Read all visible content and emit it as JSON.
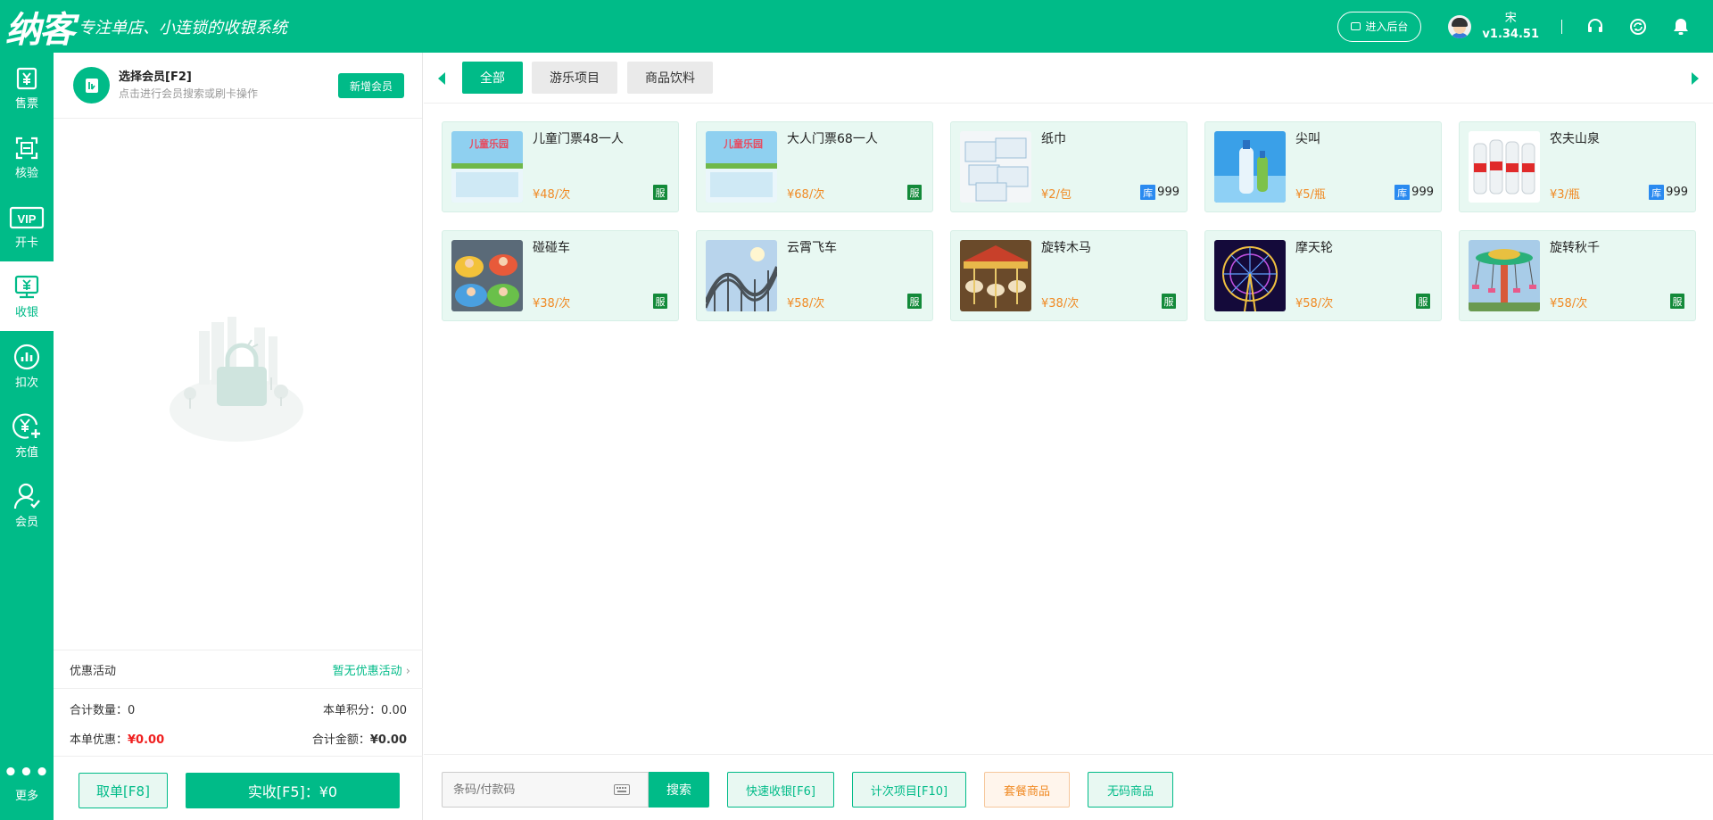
{
  "header": {
    "logo": "纳客",
    "slogan": "专注单店、小连锁的收银系统",
    "backend_label": "进入后台",
    "user_name": "宋",
    "version": "v1.34.51"
  },
  "sidebar": {
    "items": [
      {
        "label": "售票",
        "icon": "ticket-yen-icon"
      },
      {
        "label": "核验",
        "icon": "scan-icon"
      },
      {
        "label": "开卡",
        "icon": "vip-card-icon"
      },
      {
        "label": "收银",
        "icon": "cashier-icon"
      },
      {
        "label": "扣次",
        "icon": "chart-icon"
      },
      {
        "label": "充值",
        "icon": "recharge-icon"
      },
      {
        "label": "会员",
        "icon": "member-icon"
      }
    ],
    "active_index": 3,
    "more_label": "更多"
  },
  "member": {
    "title": "选择会员[F2]",
    "subtitle": "点击进行会员搜索或刷卡操作",
    "new_member_label": "新增会员"
  },
  "promo": {
    "label": "优惠活动",
    "value": "暂无优惠活动"
  },
  "summary": {
    "qty_label": "合计数量：",
    "qty_value": "0",
    "points_label": "本单积分：",
    "points_value": "0.00",
    "discount_label": "本单优惠：",
    "discount_value": "¥0.00",
    "total_label": "合计金额：",
    "total_value": "¥0.00"
  },
  "footer_left": {
    "cancel_label": "取单[F8]",
    "pay_label": "实收[F5]：¥0"
  },
  "tabs": [
    {
      "label": "全部",
      "active": true
    },
    {
      "label": "游乐项目",
      "active": false
    },
    {
      "label": "商品饮料",
      "active": false
    }
  ],
  "products": [
    {
      "name": "儿童门票48一人",
      "price": "¥48/次",
      "badge": "服",
      "img": "ticket"
    },
    {
      "name": "大人门票68一人",
      "price": "¥68/次",
      "badge": "服",
      "img": "ticket"
    },
    {
      "name": "纸巾",
      "price": "¥2/包",
      "stock_tag": "库",
      "stock": "999",
      "img": "tissue"
    },
    {
      "name": "尖叫",
      "price": "¥5/瓶",
      "stock_tag": "库",
      "stock": "999",
      "img": "drink"
    },
    {
      "name": "农夫山泉",
      "price": "¥3/瓶",
      "stock_tag": "库",
      "stock": "999",
      "img": "water"
    },
    {
      "name": "碰碰车",
      "price": "¥38/次",
      "badge": "服",
      "img": "bumper"
    },
    {
      "name": "云霄飞车",
      "price": "¥58/次",
      "badge": "服",
      "img": "coaster"
    },
    {
      "name": "旋转木马",
      "price": "¥38/次",
      "badge": "服",
      "img": "carousel"
    },
    {
      "name": "摩天轮",
      "price": "¥58/次",
      "badge": "服",
      "img": "ferris"
    },
    {
      "name": "旋转秋千",
      "price": "¥58/次",
      "badge": "服",
      "img": "swing"
    }
  ],
  "bottom": {
    "search_placeholder": "条码/付款码",
    "search_label": "搜索",
    "quick_label": "快速收银[F6]",
    "count_label": "计次项目[F10]",
    "combo_label": "套餐商品",
    "nocode_label": "无码商品"
  },
  "colors": {
    "primary": "#00bb88",
    "price": "#f08a24",
    "service_badge": "#138a3a",
    "stock_badge": "#2a8af0",
    "danger": "#f02020"
  }
}
